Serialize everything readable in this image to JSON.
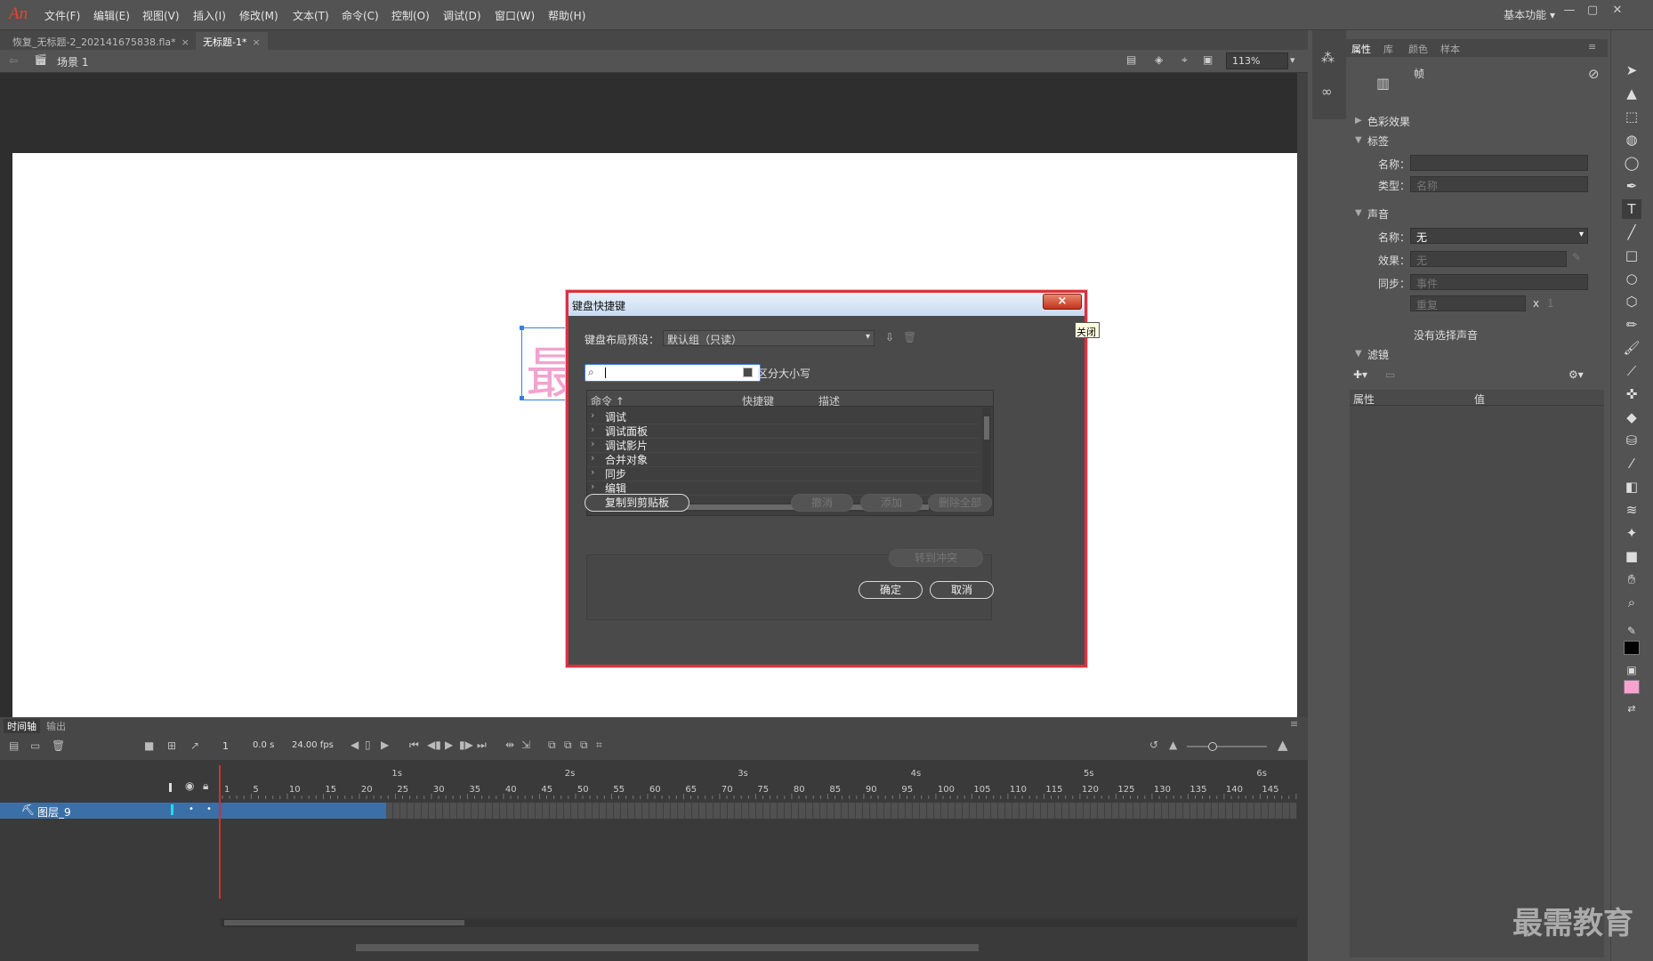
{
  "menubar": {
    "logo": "An",
    "items": [
      "文件(F)",
      "编辑(E)",
      "视图(V)",
      "插入(I)",
      "修改(M)",
      "文本(T)",
      "命令(C)",
      "控制(O)",
      "调试(D)",
      "窗口(W)",
      "帮助(H)"
    ],
    "workspace": "基本功能"
  },
  "tabs": [
    {
      "label": "恢复_无标题-2_202141675838.fla*"
    },
    {
      "label": "无标题-1*"
    }
  ],
  "scene": {
    "label": "场景 1",
    "zoom": "113%"
  },
  "stage": {
    "text_glyph": "最"
  },
  "dialog": {
    "title": "键盘快捷键",
    "close_glyph": "×",
    "tooltip": "关闭",
    "preset_label": "键盘布局预设：",
    "preset_value": "默认组（只读）",
    "search_value": "",
    "case_label": "区分大小写",
    "columns": [
      "命令 ↑",
      "快捷键",
      "描述"
    ],
    "rows": [
      "调试",
      "调试面板",
      "调试影片",
      "合并对象",
      "同步",
      "编辑"
    ],
    "copy_button": "复制到剪贴板",
    "undo_button": "撤消",
    "add_button": "添加",
    "delete_all_button": "删除全部",
    "goto_conflict_button": "转到冲突",
    "ok_button": "确定",
    "cancel_button": "取消"
  },
  "timeline": {
    "tabs": [
      "时间轴",
      "输出"
    ],
    "frame_value": "1",
    "time_value": "0.0 s",
    "fps_value": "24.00 fps",
    "seconds": [
      "1s",
      "2s",
      "3s",
      "4s",
      "5s",
      "6s"
    ],
    "frame_ticks": [
      "1",
      "5",
      "10",
      "15",
      "20",
      "25",
      "30",
      "35",
      "40",
      "45",
      "50",
      "55",
      "60",
      "65",
      "70",
      "75",
      "80",
      "85",
      "90",
      "95",
      "100",
      "105",
      "110",
      "115",
      "120",
      "125",
      "130",
      "135",
      "140",
      "145",
      "15"
    ],
    "layer_name": "图层_9"
  },
  "properties": {
    "tabs": [
      "属性",
      "库",
      "颜色",
      "样本"
    ],
    "frame_label": "帧",
    "color_effect": "色彩效果",
    "label_section": "标签",
    "name_label": "名称：",
    "type_label": "类型：",
    "type_value": "名称",
    "sound_section": "声音",
    "sound_name_label": "名称：",
    "sound_name_value": "无",
    "effect_label": "效果：",
    "effect_value": "无",
    "sync_label": "同步：",
    "sync_value": "事件",
    "repeat_value": "重复",
    "repeat_x": "x",
    "repeat_count": "1",
    "no_sound": "没有选择声音",
    "filter_section": "滤镜",
    "filter_col_prop": "属性",
    "filter_col_value": "值"
  },
  "watermark": "最需教育"
}
